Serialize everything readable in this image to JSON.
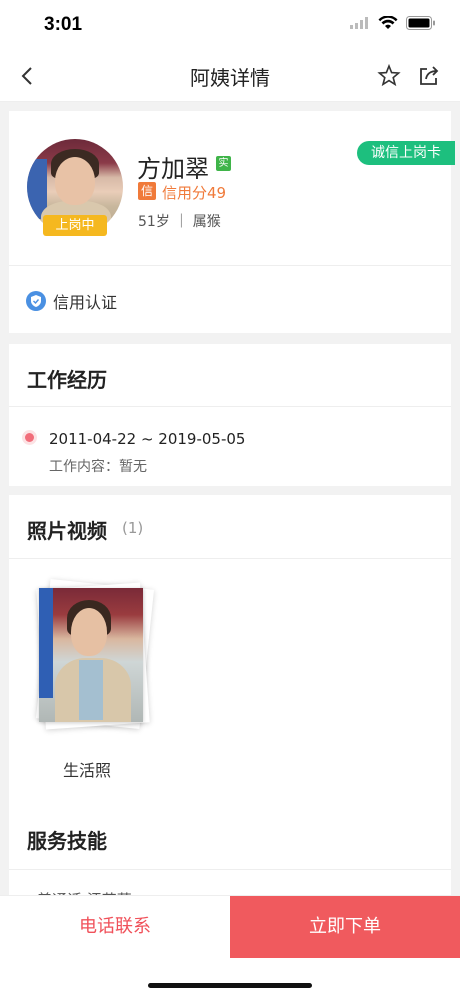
{
  "status_bar": {
    "time": "3:01"
  },
  "nav": {
    "title": "阿姨详情",
    "back_icon": "back-arrow-icon",
    "star_icon": "star-icon",
    "share_icon": "share-icon"
  },
  "profile": {
    "name": "方加翠",
    "verified_tag": "实",
    "credit_icon": "信",
    "credit_score": "信用分49",
    "age_line": "51岁 ｜ 属猴",
    "status_badge": "上岗中",
    "honest_badge": "诚信上岗卡",
    "credit_cert": "信用认证"
  },
  "work": {
    "title": "工作经历",
    "dates": "2011-04-22 ~ 2019-05-05",
    "content": "工作内容：暂无"
  },
  "photos": {
    "title": "照片视频",
    "count": "(1)",
    "caption": "生活照"
  },
  "skills": {
    "title": "服务技能",
    "partial": "普通话 汗花菜"
  },
  "bottom": {
    "phone_label": "电话联系",
    "order_label": "立即下单"
  },
  "colors": {
    "accent_red": "#f05a5e",
    "green": "#1dbf7e",
    "orange": "#f07a3a",
    "yellow": "#f5b81f"
  }
}
